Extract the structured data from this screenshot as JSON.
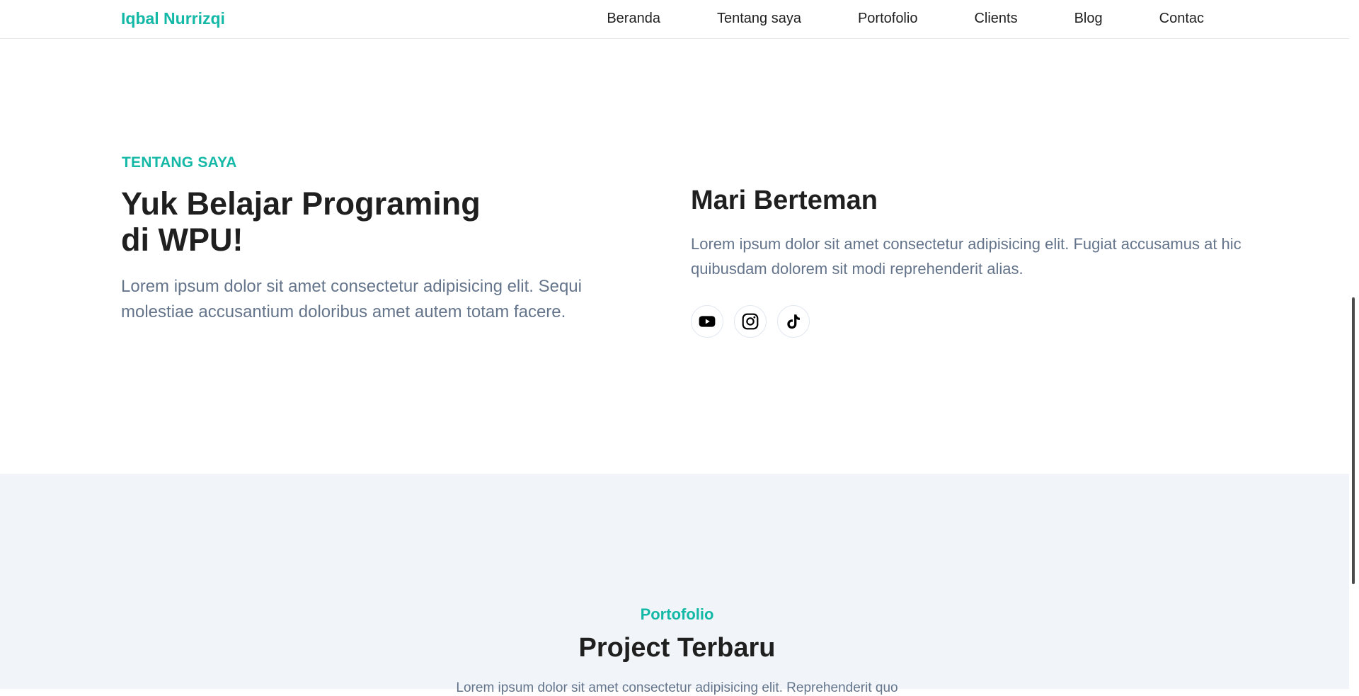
{
  "navbar": {
    "brand": "Iqbal Nurrizqi",
    "links": [
      "Beranda",
      "Tentang saya",
      "Portofolio",
      "Clients",
      "Blog",
      "Contac"
    ]
  },
  "about": {
    "label": "TENTANG SAYA",
    "title_line1": "Yuk Belajar Programing",
    "title_line2": "di WPU!",
    "text": "Lorem ipsum dolor sit amet consectetur adipisicing elit. Sequi molestiae accusantium doloribus amet autem totam facere.",
    "friend_title": "Mari Berteman",
    "friend_text": "Lorem ipsum dolor sit amet consectetur adipisicing elit. Fugiat accusamus at hic quibusdam dolorem sit modi reprehenderit alias.",
    "socials": [
      "youtube-icon",
      "instagram-icon",
      "tiktok-icon"
    ]
  },
  "portfolio": {
    "label": "Portofolio",
    "title": "Project Terbaru",
    "text": "Lorem ipsum dolor sit amet consectetur adipisicing elit. Reprehenderit quo"
  },
  "colors": {
    "accent": "#14b8a6",
    "text_dark": "#1f1f1f",
    "text_muted": "#64748b",
    "section_alt_bg": "#f1f5f9"
  }
}
